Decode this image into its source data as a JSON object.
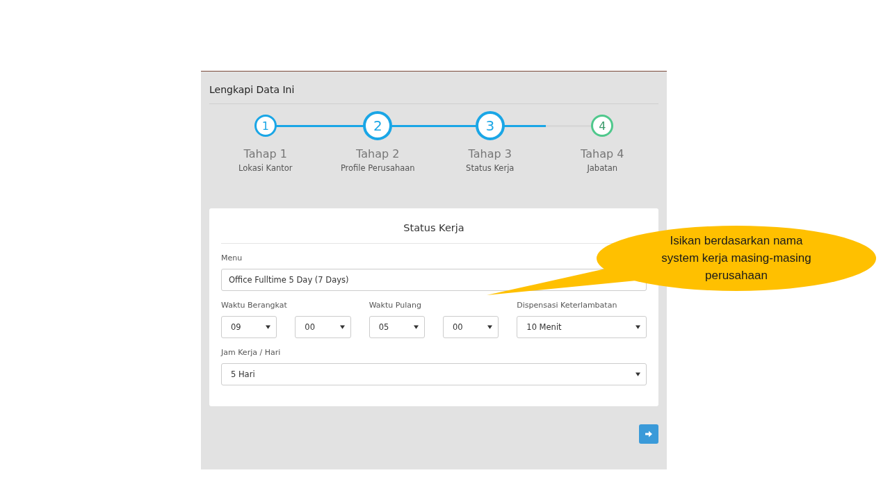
{
  "panel": {
    "title": "Lengkapi Data Ini"
  },
  "steps": [
    {
      "number": "1",
      "title": "Tahap 1",
      "subtitle": "Lokasi Kantor",
      "kind": "done"
    },
    {
      "number": "2",
      "title": "Tahap 2",
      "subtitle": "Profile Perusahaan",
      "kind": "active"
    },
    {
      "number": "3",
      "title": "Tahap 3",
      "subtitle": "Status Kerja",
      "kind": "active"
    },
    {
      "number": "4",
      "title": "Tahap 4",
      "subtitle": "Jabatan",
      "kind": "pending"
    }
  ],
  "form": {
    "title": "Status Kerja",
    "menu": {
      "label": "Menu",
      "value": "Office Fulltime 5 Day (7 Days)"
    },
    "time_groups": [
      {
        "label": "Waktu Berangkat",
        "selects": [
          "09",
          "00"
        ]
      },
      {
        "label": "Waktu Pulang",
        "selects": [
          "05",
          "00"
        ]
      },
      {
        "label": "Dispensasi Keterlambatan",
        "selects": [
          "10 Menit"
        ]
      }
    ],
    "work_days": {
      "label": "Jam Kerja / Hari",
      "value": "5 Hari"
    }
  },
  "callout": {
    "text": "Isikan berdasarkan nama system kerja masing-masing perusahaan"
  }
}
